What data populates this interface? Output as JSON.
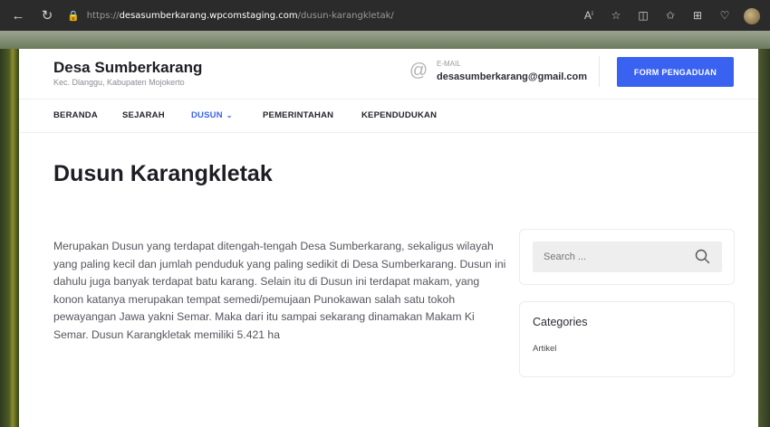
{
  "browser": {
    "url_proto": "https://",
    "url_domain": "desasumberkarang.wpcomstaging.com",
    "url_path": "/dusun-karangkletak/"
  },
  "header": {
    "site_title": "Desa Sumberkarang",
    "site_subtitle": "Kec. Dlanggu, Kabupaten Mojokerto",
    "email_label": "E-MAIL",
    "email_value": "desasumberkarang@gmail.com",
    "cta_label": "FORM PENGADUAN"
  },
  "nav": {
    "items": [
      {
        "label": "BERANDA"
      },
      {
        "label": "SEJARAH"
      },
      {
        "label": "DUSUN"
      },
      {
        "label": "PEMERINTAHAN"
      },
      {
        "label": "KEPENDUDUKAN"
      }
    ],
    "active_color": "#3a62f0"
  },
  "main": {
    "title": "Dusun Karangkletak",
    "body": "Merupakan Dusun yang terdapat ditengah-tengah Desa Sumberkarang, sekaligus wilayah yang paling kecil dan jumlah penduduk yang paling sedikit di Desa Sumberkarang. Dusun ini dahulu juga banyak terdapat batu karang. Selain itu di Dusun ini terdapat makam, yang konon katanya merupakan tempat semedi/pemujaan Punokawan salah satu tokoh pewayangan Jawa yakni Semar. Maka dari itu sampai sekarang dinamakan Makam Ki Semar. Dusun Karangkletak memiliki 5.421 ha"
  },
  "sidebar": {
    "search_placeholder": "Search ...",
    "categories_title": "Categories",
    "categories": [
      {
        "label": "Artikel"
      }
    ]
  },
  "colors": {
    "accent": "#3a62f0",
    "heading": "#1d1d24",
    "body_text": "#55555e"
  }
}
